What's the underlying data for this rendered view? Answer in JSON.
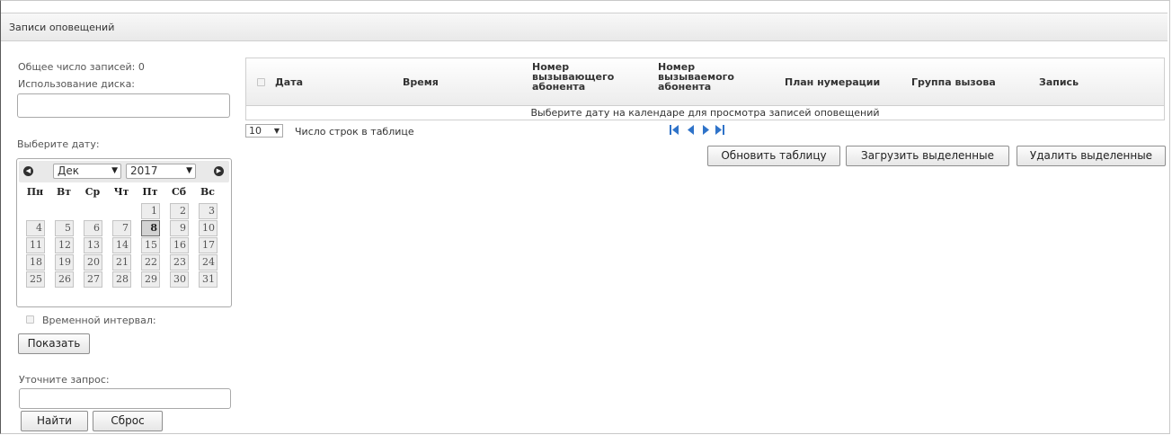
{
  "title": "Записи оповещений",
  "stats": {
    "total_label": "Общее число записей: 0",
    "disk_label": "Использование диска:",
    "disk_value": ""
  },
  "date_label": "Выберите дату:",
  "calendar": {
    "month": "Дек",
    "year": "2017",
    "weekdays": [
      "Пн",
      "Вт",
      "Ср",
      "Чт",
      "Пт",
      "Сб",
      "Вс"
    ],
    "weeks": [
      [
        "",
        "",
        "",
        "",
        "1",
        "2",
        "3"
      ],
      [
        "4",
        "5",
        "6",
        "7",
        "8",
        "9",
        "10"
      ],
      [
        "11",
        "12",
        "13",
        "14",
        "15",
        "16",
        "17"
      ],
      [
        "18",
        "19",
        "20",
        "21",
        "22",
        "23",
        "24"
      ],
      [
        "25",
        "26",
        "27",
        "28",
        "29",
        "30",
        "31"
      ]
    ],
    "selected_day": "8"
  },
  "interval_label": "Временной интервал:",
  "show_button": "Показать",
  "refine": {
    "label": "Уточните запрос:",
    "value": "",
    "find_button": "Найти",
    "reset_button": "Сброс"
  },
  "table": {
    "columns": [
      {
        "key": "date",
        "label": "Дата"
      },
      {
        "key": "time",
        "label": "Время"
      },
      {
        "key": "caller",
        "label": "Номер\nвызывающего\nабонента"
      },
      {
        "key": "callee",
        "label": "Номер\nвызываемого\nабонента"
      },
      {
        "key": "plan",
        "label": "План нумерации"
      },
      {
        "key": "group",
        "label": "Группа вызова"
      },
      {
        "key": "record",
        "label": "Запись"
      }
    ],
    "empty_message": "Выберите дату на календаре для просмотра записей оповещений"
  },
  "pager": {
    "rows_value": "10",
    "rows_label": "Число строк в таблице"
  },
  "actions": {
    "refresh": "Обновить таблицу",
    "download": "Загрузить выделенные",
    "delete": "Удалить выделенные"
  },
  "colors": {
    "pager_icon": "#2f73c9"
  }
}
